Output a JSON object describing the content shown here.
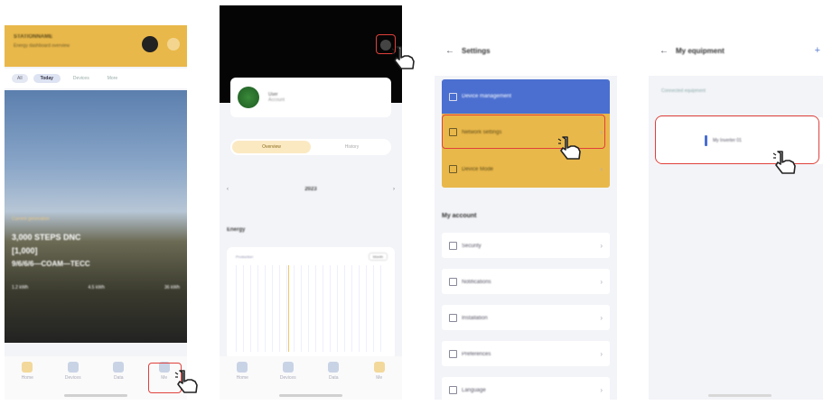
{
  "steps": [
    {
      "header": {
        "title": "STATIONNAME",
        "subtitle": "Energy dashboard overview"
      },
      "tabs": [
        "All",
        "Today",
        "Devices",
        "More"
      ],
      "hero": {
        "caption": "Current generation",
        "line1": "3,000 STEPS DNC",
        "line2": "[1,000]",
        "line3": "9/6/6/6—COAM—TECC",
        "stats": [
          "1.2 kWh",
          "4.5 kWh",
          "36 kWh"
        ]
      },
      "nav": [
        "Home",
        "Devices",
        "Data",
        "Me"
      ]
    },
    {
      "profile": {
        "name": "User",
        "sub": "Account"
      },
      "segments": [
        "Overview",
        "History"
      ],
      "date": "2023",
      "section": "Energy",
      "legend": "Production",
      "period": "Month",
      "nav": [
        "Home",
        "Devices",
        "Data",
        "Me"
      ]
    },
    {
      "title": "Settings",
      "highlighted": [
        "Device management",
        "Network settings",
        "Device Mode"
      ],
      "section": "My account",
      "items": [
        "Security",
        "Notifications",
        "Installation",
        "Preferences",
        "Language"
      ]
    },
    {
      "title": "My equipment",
      "breadcrumb": "Connected equipment",
      "device": "My Inverter 01"
    }
  ],
  "colors": {
    "accent": "#e9b84a",
    "blue": "#4a6fd0",
    "highlight_border": "#e0413b"
  },
  "icons": [
    "hand-pointer-icon",
    "gear-icon",
    "back-arrow-icon",
    "chevron-right-icon",
    "plus-icon"
  ]
}
